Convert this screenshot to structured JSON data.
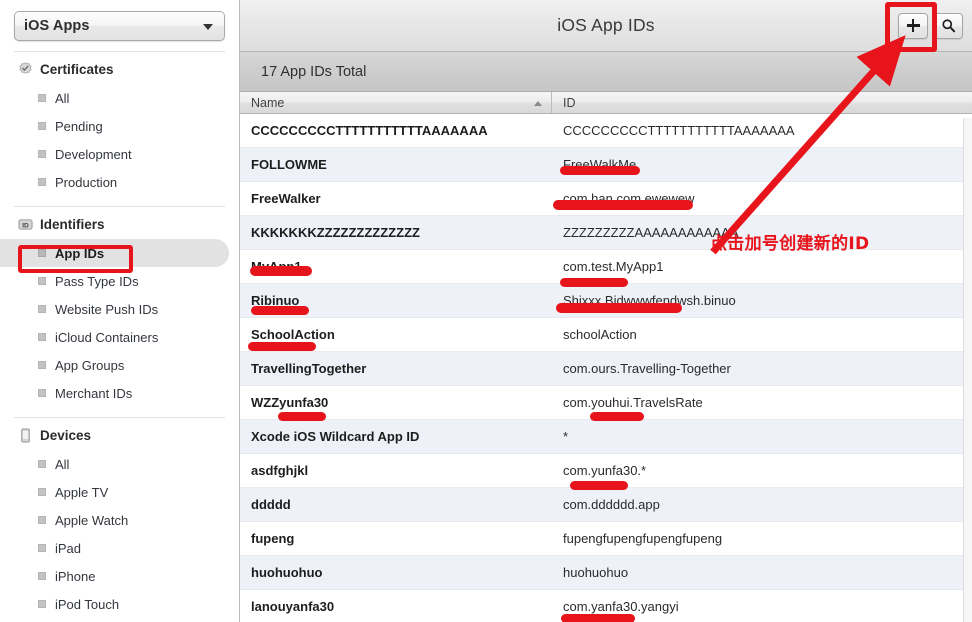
{
  "sidebar": {
    "team_selector": {
      "label": "iOS Apps",
      "icon": "chevron-down-icon"
    },
    "groups": [
      {
        "title": "Certificates",
        "icon": "certificate-seal-icon",
        "items": [
          {
            "label": "All",
            "selected": false
          },
          {
            "label": "Pending",
            "selected": false
          },
          {
            "label": "Development",
            "selected": false
          },
          {
            "label": "Production",
            "selected": false
          }
        ]
      },
      {
        "title": "Identifiers",
        "icon": "id-badge-icon",
        "items": [
          {
            "label": "App IDs",
            "selected": true
          },
          {
            "label": "Pass Type IDs",
            "selected": false
          },
          {
            "label": "Website Push IDs",
            "selected": false
          },
          {
            "label": "iCloud Containers",
            "selected": false
          },
          {
            "label": "App Groups",
            "selected": false
          },
          {
            "label": "Merchant IDs",
            "selected": false
          }
        ]
      },
      {
        "title": "Devices",
        "icon": "device-phone-icon",
        "items": [
          {
            "label": "All",
            "selected": false
          },
          {
            "label": "Apple TV",
            "selected": false
          },
          {
            "label": "Apple Watch",
            "selected": false
          },
          {
            "label": "iPad",
            "selected": false
          },
          {
            "label": "iPhone",
            "selected": false
          },
          {
            "label": "iPod Touch",
            "selected": false
          }
        ]
      }
    ]
  },
  "header": {
    "title": "iOS App IDs",
    "add_button": {
      "icon": "plus-icon",
      "label": "+"
    },
    "search_button": {
      "icon": "search-icon"
    }
  },
  "count_bar": {
    "text": "17 App IDs Total"
  },
  "table": {
    "columns": [
      {
        "key": "name",
        "label": "Name",
        "sort": "ascending",
        "sort_icon": "triangle-up-icon"
      },
      {
        "key": "id",
        "label": "ID",
        "sort": "none"
      }
    ],
    "rows": [
      {
        "name": "CCCCCCCCCTTTTTTTTTTTAAAAAAA",
        "id": "CCCCCCCCCTTTTTTTTTTTAAAAAAA"
      },
      {
        "name": "FOLLOWME",
        "id": "FreeWalkMe"
      },
      {
        "name": "FreeWalker",
        "id": "com.han.com.ewewew"
      },
      {
        "name": "KKKKKKKZZZZZZZZZZZZZ",
        "id": "ZZZZZZZZZAAAAAAAAAAAA"
      },
      {
        "name": "MyApp1",
        "id": "com.test.MyApp1"
      },
      {
        "name": "Ribinuo",
        "id": "Shixxx.Bidwwwfendwsh.binuo"
      },
      {
        "name": "SchoolAction",
        "id": "schoolAction"
      },
      {
        "name": "TravellingTogether",
        "id": "com.ours.Travelling-Together"
      },
      {
        "name": "WZZyunfa30",
        "id": "com.youhui.TravelsRate"
      },
      {
        "name": "Xcode iOS Wildcard App ID",
        "id": "*"
      },
      {
        "name": "asdfghjkl",
        "id": "com.yunfa30.*"
      },
      {
        "name": "ddddd",
        "id": "com.dddddd.app"
      },
      {
        "name": "fupeng",
        "id": "fupengfupengfupengfupeng"
      },
      {
        "name": "huohuohuo",
        "id": "huohuohuo"
      },
      {
        "name": "lanouyanfa30",
        "id": "com.yanfa30.yangyi"
      }
    ]
  },
  "annotations": {
    "note_text": "点击加号创建新的ID",
    "highlight_color": "#e8141b",
    "arrow": {
      "from": "note-area",
      "to": "add-button"
    },
    "boxes": [
      {
        "target": "add-button"
      },
      {
        "target": "sidebar-item-app-ids"
      }
    ]
  }
}
